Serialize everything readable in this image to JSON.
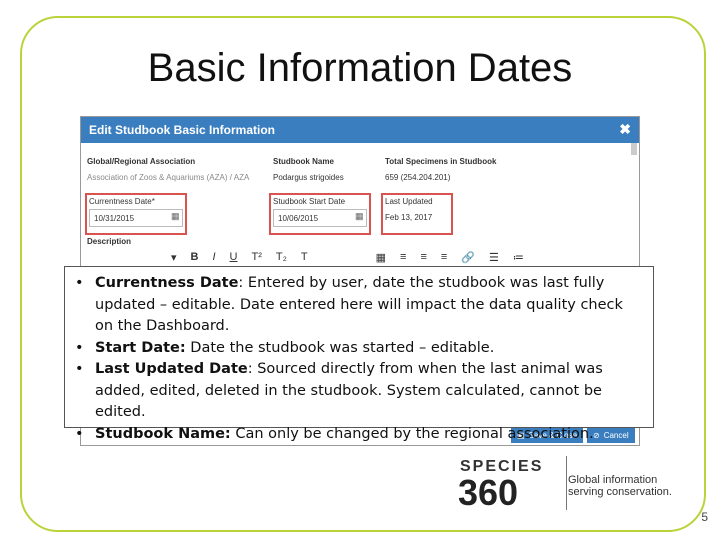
{
  "title": "Basic Information Dates",
  "dialog": {
    "title": "Edit Studbook Basic Information",
    "fields": {
      "association_label": "Global/Regional Association",
      "association_value": "Association of Zoos & Aquariums (AZA) / AZA",
      "studbook_name_label": "Studbook Name",
      "studbook_name_value": "Podargus strigoides",
      "total_specimens_label": "Total Specimens in Studbook",
      "total_specimens_value": "659 (254.204.201)",
      "currentness_label": "Currentness Date*",
      "currentness_value": "10/31/2015",
      "start_date_label": "Studbook Start Date",
      "start_date_value": "10/06/2015",
      "last_updated_label": "Last Updated",
      "last_updated_value": "Feb 13, 2017",
      "description_label": "Description"
    },
    "buttons": {
      "save": "Save & Close",
      "cancel": "Cancel"
    }
  },
  "callout": {
    "items": [
      {
        "term": "Currentness Date",
        "text": ": Entered by user, date the studbook was last fully updated – editable. Date entered here will impact the data quality check on the Dashboard."
      },
      {
        "term": "Start Date:",
        "text": " Date the studbook was started – editable."
      },
      {
        "term": "Last Updated Date",
        "text": ": Sourced directly from when the last animal was added, edited, deleted in the studbook.  System calculated, cannot be edited."
      },
      {
        "term": "Studbook Name:",
        "text": "  Can only be changed by the regional association."
      }
    ]
  },
  "logo": {
    "name_top": "SPECIES",
    "name_num": "360",
    "tag1": "Global information",
    "tag2": "serving conservation."
  },
  "page_number": "5",
  "colors": {
    "frame": "#b9d33b",
    "header": "#3a7ebf",
    "highlight": "#d9534f"
  }
}
